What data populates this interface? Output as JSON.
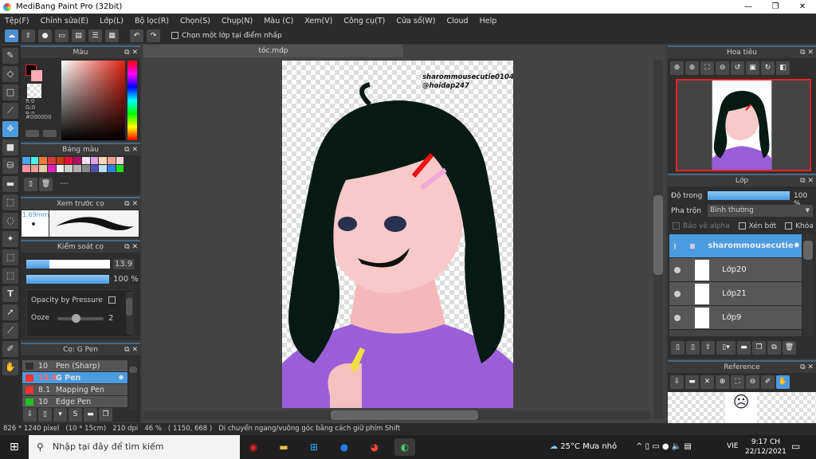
{
  "app": {
    "title": "MediBang Paint Pro (32bit)"
  },
  "menu": [
    "Tệp(F)",
    "Chỉnh sửa(E)",
    "Lớp(L)",
    "Bộ lọc(R)",
    "Chọn(S)",
    "Chụp(N)",
    "Màu (C)",
    "Xem(V)",
    "Công cụ(T)",
    "Cửa sổ(W)",
    "Cloud",
    "Help"
  ],
  "toolbar": {
    "checkbox_label": "Chọn một lớp tại điểm nhấp",
    "checked": false
  },
  "color_panel": {
    "title": "Màu",
    "r": "R:0",
    "g": "G:0",
    "b": "B:0",
    "hex": "#000000",
    "primary": "#000000",
    "secondary": "#ffaab4"
  },
  "palette_panel": {
    "title": "Bảng màu",
    "swatches": [
      "#4aa3e8",
      "#4af0f0",
      "#e87a3a",
      "#d83a3a",
      "#c83a10",
      "#e8103a",
      "#b01060",
      "#f8e0f0",
      "#e0a0e8",
      "#f8d8b8",
      "#f0a090",
      "#f8d0d8",
      "#f890a8",
      "#f0a090",
      "#e8c8a0",
      "#e020c0",
      "#f4f4f4",
      "#d0d0d0",
      "#b0b0b0",
      "#888888",
      "#5050b0",
      "#b8e0f8",
      "#3080e0",
      "#20e020"
    ],
    "name": "---"
  },
  "brush_preview": {
    "title": "Xem trước cọ",
    "size": "1.69mm"
  },
  "brush_control": {
    "title": "Kiểm soát cọ",
    "size": "13.9",
    "size_fraction": 0.28,
    "opacity": "100 %",
    "opacity_fraction": 1.0,
    "opacity_by_pressure": "Opacity by Pressure",
    "ooze_label": "Ooze",
    "ooze_value": "2"
  },
  "brush_list": {
    "title": "Cọ: G Pen",
    "items": [
      {
        "size": "10",
        "name": "Pen (Sharp)",
        "color": "#333333"
      },
      {
        "size": "13.9",
        "name": "G Pen",
        "color": "#ff3030",
        "selected": true
      },
      {
        "size": "8.1",
        "name": "Mapping Pen",
        "color": "#ff3030"
      },
      {
        "size": "10",
        "name": "Edge Pen",
        "color": "#20c020"
      }
    ]
  },
  "document": {
    "tab": "tóc.mdp",
    "watermark_line1": "sharommousecutie0104",
    "watermark_line2": "@hoidap247"
  },
  "navigator": {
    "title": "Hoa tiêu"
  },
  "layers": {
    "title": "Lớp",
    "opacity_label": "Độ trong",
    "opacity": "100 %",
    "opacity_fraction": 1.0,
    "blend_label": "Pha trộn",
    "blend": "Bình thường",
    "protect_alpha": "Bảo vệ alpha",
    "clipping": "Xén bớt",
    "lock": "Khóa",
    "items": [
      {
        "name": "sharommousecutie",
        "selected": true
      },
      {
        "name": "Lớp20"
      },
      {
        "name": "Lớp21"
      },
      {
        "name": "Lớp9"
      }
    ]
  },
  "reference": {
    "title": "Reference"
  },
  "status": {
    "size": "826 * 1240 pixel",
    "cm": "(10 * 15cm)",
    "dpi": "210 dpi",
    "zoom": "46 %",
    "coords": "( 1150, 668 )",
    "hint": "Di chuyển ngang/vuông góc bằng cách giữ phím Shift"
  },
  "taskbar": {
    "search_placeholder": "Nhập tại đây để tìm kiếm",
    "weather": "25°C  Mưa nhỏ",
    "lang": "VIE",
    "time": "9:17 CH",
    "date": "22/12/2021"
  }
}
